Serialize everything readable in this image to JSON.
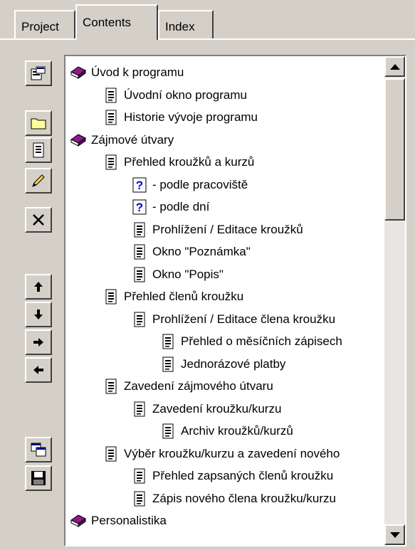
{
  "tabs": [
    {
      "label": "Project"
    },
    {
      "label": "Contents"
    },
    {
      "label": "Index"
    }
  ],
  "toolbar": {
    "buttons": [
      {
        "icon": "properties-icon"
      },
      {
        "icon": "folder-icon"
      },
      {
        "icon": "page-icon"
      },
      {
        "icon": "pencil-icon"
      },
      {
        "icon": "delete-icon"
      },
      {
        "icon": "arrow-up-icon"
      },
      {
        "icon": "arrow-down-icon"
      },
      {
        "icon": "arrow-right-icon"
      },
      {
        "icon": "arrow-left-icon"
      },
      {
        "icon": "windows-icon"
      },
      {
        "icon": "save-icon"
      }
    ]
  },
  "tree": {
    "items": [
      {
        "label": "Úvod k programu",
        "icon": "book-icon",
        "level": 0
      },
      {
        "label": "Úvodní okno programu",
        "icon": "page-icon",
        "level": 1
      },
      {
        "label": "Historie vývoje programu",
        "icon": "page-icon",
        "level": 1
      },
      {
        "label": "Zájmové útvary",
        "icon": "book-icon",
        "level": 0
      },
      {
        "label": "Přehled kroužků a  kurzů",
        "icon": "page-icon",
        "level": 1
      },
      {
        "label": "- podle pracoviště",
        "icon": "help-icon",
        "level": 2
      },
      {
        "label": "- podle dní",
        "icon": "help-icon",
        "level": 2
      },
      {
        "label": "Prohlížení / Editace kroužků",
        "icon": "page-icon",
        "level": 2
      },
      {
        "label": "Okno \"Poznámka\"",
        "icon": "page-icon",
        "level": 2
      },
      {
        "label": "Okno \"Popis\"",
        "icon": "page-icon",
        "level": 2
      },
      {
        "label": "Přehled členů kroužku",
        "icon": "page-icon",
        "level": 1
      },
      {
        "label": "Prohlížení / Editace člena kroužku",
        "icon": "page-icon",
        "level": 2
      },
      {
        "label": "Přehled o měsíčních zápisech",
        "icon": "page-icon",
        "level": 3
      },
      {
        "label": "Jednorázové platby",
        "icon": "page-icon",
        "level": 3
      },
      {
        "label": "Zavedení zájmového útvaru",
        "icon": "page-icon",
        "level": 1
      },
      {
        "label": "Zavedení kroužku/kurzu",
        "icon": "page-icon",
        "level": 2
      },
      {
        "label": "Archiv kroužků/kurzů",
        "icon": "page-icon",
        "level": 3
      },
      {
        "label": "Výběr kroužku/kurzu a zavedení nového",
        "icon": "page-icon",
        "level": 1
      },
      {
        "label": "Přehled zapsaných členů kroužku",
        "icon": "page-icon",
        "level": 2
      },
      {
        "label": "Zápis nového člena kroužku/kurzu",
        "icon": "page-icon",
        "level": 2
      },
      {
        "label": "Personalistika",
        "icon": "book-icon",
        "level": 0
      }
    ]
  },
  "scrollbar": {
    "up_icon": "scroll-up-icon",
    "down_icon": "scroll-down-icon"
  }
}
